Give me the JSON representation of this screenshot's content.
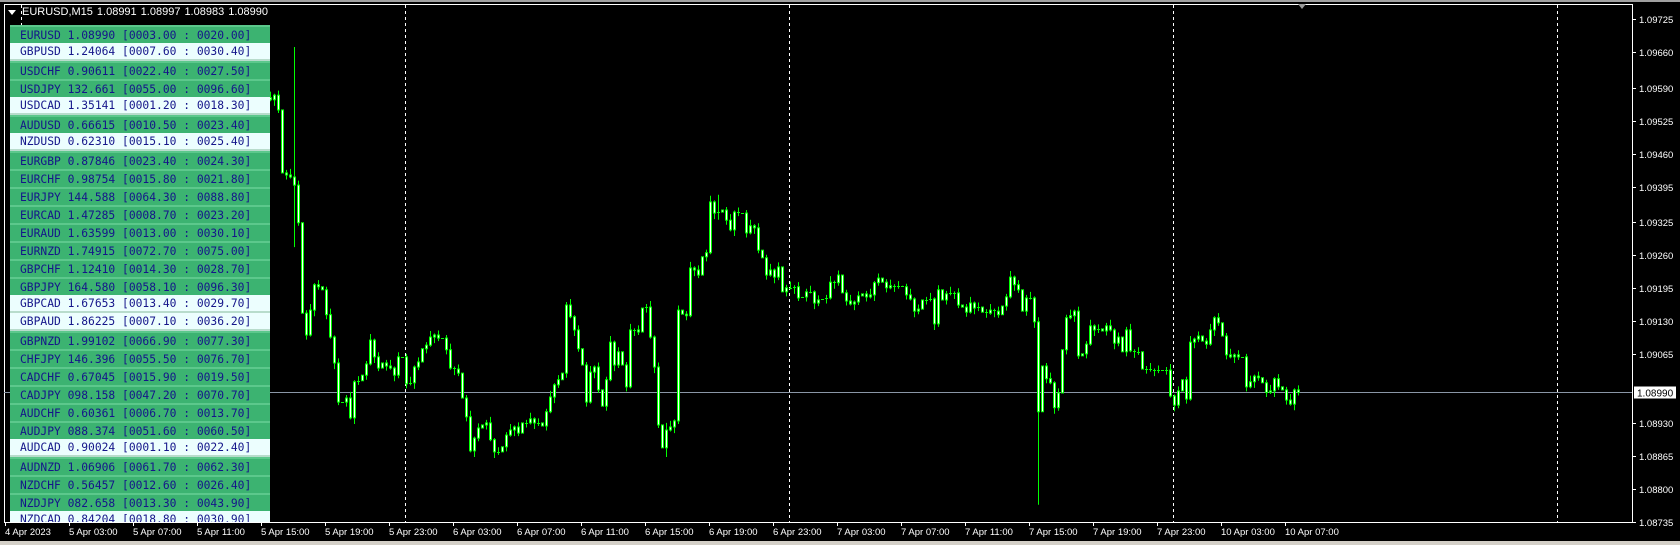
{
  "header": {
    "symbol_timeframe": "EURUSD,M15",
    "ohlc": [
      "1.08991",
      "1.08997",
      "1.08983",
      "1.08990"
    ],
    "menu_icon": "triangle-down-icon"
  },
  "panel": {
    "rows": [
      {
        "symbol": "EURUSD",
        "price": "1.08990",
        "range": "[0003.00 : 0020.00]",
        "highlighted": false
      },
      {
        "symbol": "GBPUSD",
        "price": "1.24064",
        "range": "[0007.60 : 0030.40]",
        "highlighted": true
      },
      {
        "symbol": "USDCHF",
        "price": "0.90611",
        "range": "[0022.40 : 0027.50]",
        "highlighted": false
      },
      {
        "symbol": "USDJPY",
        "price": "132.661",
        "range": "[0055.00 : 0096.60]",
        "highlighted": false
      },
      {
        "symbol": "USDCAD",
        "price": "1.35141",
        "range": "[0001.20 : 0018.30]",
        "highlighted": true
      },
      {
        "symbol": "AUDUSD",
        "price": "0.66615",
        "range": "[0010.50 : 0023.40]",
        "highlighted": false
      },
      {
        "symbol": "NZDUSD",
        "price": "0.62310",
        "range": "[0015.10 : 0025.40]",
        "highlighted": true
      },
      {
        "symbol": "EURGBP",
        "price": "0.87846",
        "range": "[0023.40 : 0024.30]",
        "highlighted": false
      },
      {
        "symbol": "EURCHF",
        "price": "0.98754",
        "range": "[0015.80 : 0021.80]",
        "highlighted": false
      },
      {
        "symbol": "EURJPY",
        "price": "144.588",
        "range": "[0064.30 : 0088.80]",
        "highlighted": false
      },
      {
        "symbol": "EURCAD",
        "price": "1.47285",
        "range": "[0008.70 : 0023.20]",
        "highlighted": false
      },
      {
        "symbol": "EURAUD",
        "price": "1.63599",
        "range": "[0013.00 : 0030.10]",
        "highlighted": false
      },
      {
        "symbol": "EURNZD",
        "price": "1.74915",
        "range": "[0072.70 : 0075.00]",
        "highlighted": false
      },
      {
        "symbol": "GBPCHF",
        "price": "1.12410",
        "range": "[0014.30 : 0028.70]",
        "highlighted": false
      },
      {
        "symbol": "GBPJPY",
        "price": "164.580",
        "range": "[0058.10 : 0096.30]",
        "highlighted": false
      },
      {
        "symbol": "GBPCAD",
        "price": "1.67653",
        "range": "[0013.40 : 0029.70]",
        "highlighted": true
      },
      {
        "symbol": "GBPAUD",
        "price": "1.86225",
        "range": "[0007.10 : 0036.20]",
        "highlighted": true
      },
      {
        "symbol": "GBPNZD",
        "price": "1.99102",
        "range": "[0066.90 : 0077.30]",
        "highlighted": false
      },
      {
        "symbol": "CHFJPY",
        "price": "146.396",
        "range": "[0055.50 : 0076.70]",
        "highlighted": false
      },
      {
        "symbol": "CADCHF",
        "price": "0.67045",
        "range": "[0015.90 : 0019.50]",
        "highlighted": false
      },
      {
        "symbol": "CADJPY",
        "price": "098.158",
        "range": "[0047.20 : 0070.70]",
        "highlighted": false
      },
      {
        "symbol": "AUDCHF",
        "price": "0.60361",
        "range": "[0006.70 : 0013.70]",
        "highlighted": false
      },
      {
        "symbol": "AUDJPY",
        "price": "088.374",
        "range": "[0051.60 : 0060.50]",
        "highlighted": false
      },
      {
        "symbol": "AUDCAD",
        "price": "0.90024",
        "range": "[0001.10 : 0022.40]",
        "highlighted": true
      },
      {
        "symbol": "AUDNZD",
        "price": "1.06906",
        "range": "[0061.70 : 0062.30]",
        "highlighted": false
      },
      {
        "symbol": "NZDCHF",
        "price": "0.56457",
        "range": "[0012.60 : 0026.40]",
        "highlighted": false
      },
      {
        "symbol": "NZDJPY",
        "price": "082.658",
        "range": "[0013.30 : 0043.90]",
        "highlighted": false
      },
      {
        "symbol": "NZDCAD",
        "price": "0.84204",
        "range": "[0018.80 : 0030.90]",
        "highlighted": true
      }
    ]
  },
  "colors": {
    "background": "#000000",
    "candle": "#00ff00",
    "candle_body": "#ffffff",
    "grid_frame": "#ffffff",
    "current_price_line": "#8a96a6",
    "panel_row": "#3cb371",
    "panel_row_highlight": "#ecfefe",
    "panel_text": "#15158a"
  },
  "chart_data": {
    "type": "candlestick",
    "timeframe": "M15",
    "start": "5 Apr 15:00",
    "current_price": "1.08990",
    "ylim": [
      1.08735,
      1.09725
    ],
    "y_ticks": [
      "1.09725",
      "1.09660",
      "1.09590",
      "1.09525",
      "1.09460",
      "1.09395",
      "1.09325",
      "1.09260",
      "1.09195",
      "1.09130",
      "1.09065",
      "1.08930",
      "1.08865",
      "1.08800",
      "1.08735"
    ],
    "x_ticks": [
      "4 Apr 2023",
      "5 Apr 03:00",
      "5 Apr 07:00",
      "5 Apr 11:00",
      "5 Apr 15:00",
      "5 Apr 19:00",
      "5 Apr 23:00",
      "6 Apr 03:00",
      "6 Apr 07:00",
      "6 Apr 11:00",
      "6 Apr 15:00",
      "6 Apr 19:00",
      "6 Apr 23:00",
      "7 Apr 03:00",
      "7 Apr 07:00",
      "7 Apr 11:00",
      "7 Apr 15:00",
      "7 Apr 19:00",
      "7 Apr 23:00",
      "10 Apr 03:00",
      "10 Apr 07:00"
    ],
    "closes": [
      1.09566,
      1.0957,
      1.09566,
      1.09575,
      1.09546,
      1.09422,
      1.09418,
      1.09414,
      1.09398,
      1.09324,
      1.09146,
      1.09103,
      1.09152,
      1.09202,
      1.09198,
      1.09192,
      1.09143,
      1.09099,
      1.09048,
      1.08971,
      1.08971,
      1.08979,
      1.0894,
      1.09011,
      1.09013,
      1.09024,
      1.09046,
      1.09093,
      1.0906,
      1.09038,
      1.09048,
      1.09042,
      1.09038,
      1.09024,
      1.0906,
      1.0906,
      1.09007,
      1.09009,
      1.0904,
      1.0905,
      1.09076,
      1.09083,
      1.09099,
      1.09103,
      1.09097,
      1.09097,
      1.09074,
      1.09038,
      1.09036,
      1.09028,
      1.08979,
      1.08942,
      1.08875,
      1.089,
      1.0892,
      1.08926,
      1.0893,
      1.08897,
      1.08873,
      1.08873,
      1.08883,
      1.08906,
      1.08916,
      1.08922,
      1.0891,
      1.0893,
      1.0893,
      1.08938,
      1.0893,
      1.0893,
      1.08924,
      1.08952,
      1.08981,
      1.09005,
      1.09015,
      1.09028,
      1.09162,
      1.09139,
      1.09113,
      1.09076,
      1.09044,
      1.08971,
      1.0903,
      1.0904,
      1.08995,
      1.08963,
      1.09015,
      1.09089,
      1.09044,
      1.0907,
      1.09044,
      1.09001,
      1.09113,
      1.09113,
      1.09109,
      1.09156,
      1.09158,
      1.09099,
      1.0904,
      1.08926,
      1.08881,
      1.08916,
      1.08922,
      1.08934,
      1.09152,
      1.09144,
      1.09141,
      1.09235,
      1.09231,
      1.09221,
      1.09257,
      1.09265,
      1.09365,
      1.09343,
      1.09345,
      1.09349,
      1.09329,
      1.0931,
      1.09345,
      1.09343,
      1.09343,
      1.09304,
      1.09318,
      1.09314,
      1.0927,
      1.09255,
      1.09221,
      1.09231,
      1.09217,
      1.09237,
      1.09188,
      1.09196,
      1.09196,
      1.09198,
      1.09176,
      1.09178,
      1.09188,
      1.09188,
      1.09166,
      1.09172,
      1.09174,
      1.09176,
      1.09207,
      1.09206,
      1.09221,
      1.09186,
      1.0917,
      1.09164,
      1.09168,
      1.0918,
      1.09184,
      1.09178,
      1.09182,
      1.09206,
      1.09215,
      1.09207,
      1.09196,
      1.092,
      1.092,
      1.092,
      1.09198,
      1.09182,
      1.09174,
      1.0915,
      1.09154,
      1.09172,
      1.09172,
      1.09174,
      1.09125,
      1.09192,
      1.09172,
      1.09184,
      1.09186,
      1.09186,
      1.09162,
      1.09158,
      1.09148,
      1.09166,
      1.09156,
      1.09158,
      1.09148,
      1.09146,
      1.09152,
      1.0915,
      1.09143,
      1.0916,
      1.09178,
      1.09217,
      1.09202,
      1.09192,
      1.0915,
      1.09176,
      1.09176,
      1.09129,
      1.08952,
      1.09042,
      1.09017,
      1.09009,
      1.0896,
      1.08989,
      1.09074,
      1.09137,
      1.09141,
      1.0915,
      1.09062,
      1.09066,
      1.09085,
      1.09121,
      1.09113,
      1.09115,
      1.09111,
      1.09121,
      1.09113,
      1.09087,
      1.09099,
      1.0907,
      1.09113,
      1.09072,
      1.0907,
      1.0907,
      1.09036,
      1.09036,
      1.09034,
      1.09034,
      1.09034,
      1.09034,
      1.09034,
      1.08983,
      1.08965,
      1.08993,
      1.09015,
      1.08977,
      1.09089,
      1.09095,
      1.09101,
      1.09091,
      1.09085,
      1.09113,
      1.09137,
      1.09127,
      1.09101,
      1.09064,
      1.0906,
      1.09064,
      1.0906,
      1.0906,
      1.09001,
      1.09011,
      1.09022,
      1.09019,
      1.09009,
      1.0899,
      1.08993,
      1.09017,
      1.09001,
      1.08995,
      1.08975,
      1.08967,
      1.08995,
      1.0899
    ],
    "extremes": [
      {
        "t": "5 Apr 17:00",
        "high": 1.0967,
        "low": 1.09276
      },
      {
        "t": "6 Apr 16:15",
        "high": 1.0893,
        "low": 1.08863
      },
      {
        "t": "6 Apr 19:30",
        "high": 1.09379,
        "low": 1.0933
      },
      {
        "t": "7 Apr 15:30",
        "high": 1.09135,
        "low": 1.08769
      }
    ]
  }
}
